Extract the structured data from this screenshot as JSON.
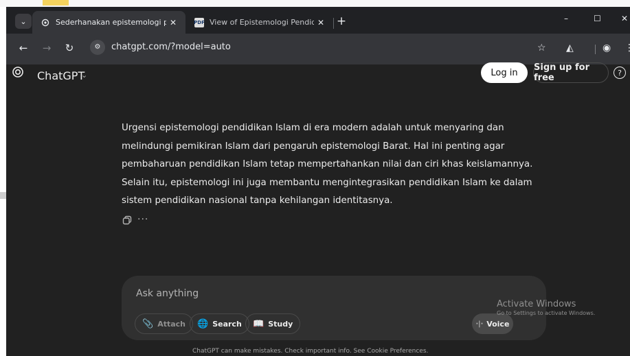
{
  "browser": {
    "tabs": [
      {
        "title": "Sederhanakan epistemologi pe",
        "favicon": "chatgpt-logo-icon",
        "active": true
      },
      {
        "title": "View of Epistemologi Pendidika",
        "favicon": "pdf-icon",
        "active": false
      }
    ],
    "new_tab_label": "+",
    "url": "chatgpt.com/?model=auto",
    "icons": [
      "tab-search-icon",
      "back-icon",
      "forward-icon",
      "reload-icon",
      "site-info-icon",
      "bookmark-star-icon",
      "extensions-icon",
      "profile-icon",
      "menu-icon",
      "minimize-icon",
      "maximize-icon",
      "close-icon"
    ]
  },
  "header": {
    "brand": "ChatGPT",
    "login_label": "Log in",
    "signup_label": "Sign up for free",
    "help_label": "?"
  },
  "response": {
    "lines": [
      "Urgensi epistemologi pendidikan Islam di era modern adalah untuk menyaring dan",
      "melindungi pemikiran Islam dari pengaruh epistemologi Barat. Hal ini penting agar",
      "pembaharuan pendidikan Islam tetap mempertahankan nilai dan ciri khas keislamannya.",
      "Selain itu, epistemologi ini juga membantu mengintegrasikan pendidikan Islam ke dalam",
      "sistem pendidikan nasional tanpa kehilangan identitasnya."
    ],
    "more_label": "···"
  },
  "composer": {
    "placeholder": "Ask anything",
    "attach_label": "Attach",
    "search_label": "Search",
    "study_label": "Study",
    "voice_label": "Voice"
  },
  "footer": {
    "note": "ChatGPT can make mistakes. Check important info. See Cookie Preferences."
  },
  "watermark": {
    "title": "Activate Windows",
    "subtitle": "Go to Settings to activate Windows."
  },
  "colors": {
    "background": "#212121",
    "composer": "#303030",
    "text": "#ececec",
    "tab_strip": "#202124",
    "toolbar": "#35363a"
  }
}
